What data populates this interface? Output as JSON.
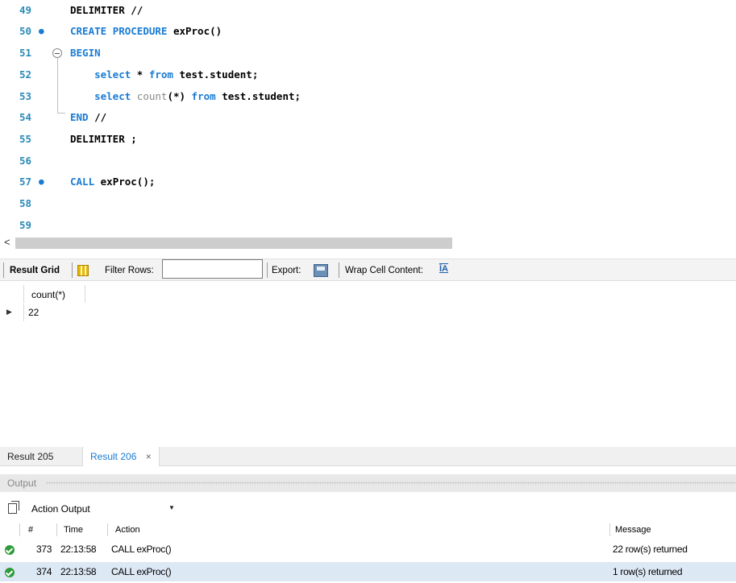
{
  "editor": {
    "lines": [
      {
        "num": "49",
        "code": "DELIMITER //"
      },
      {
        "num": "50",
        "code": "CREATE PROCEDURE exProc()"
      },
      {
        "num": "51",
        "code": "BEGIN"
      },
      {
        "num": "52",
        "code": "    select * from test.student;"
      },
      {
        "num": "53",
        "code": "    select count(*) from test.student;"
      },
      {
        "num": "54",
        "code": "END //"
      },
      {
        "num": "55",
        "code": "DELIMITER ;"
      },
      {
        "num": "56",
        "code": ""
      },
      {
        "num": "57",
        "code": "CALL exProc();"
      },
      {
        "num": "58",
        "code": ""
      },
      {
        "num": "59",
        "code": ""
      }
    ],
    "statement_marker": "●",
    "colors": {
      "keyword": "#1a7bd3",
      "function": "#8a8a8a",
      "line_number": "#2a8ab8"
    }
  },
  "scrollbar": {
    "left_arrow": "<"
  },
  "grid_toolbar": {
    "result_grid_label": "Result Grid",
    "filter_rows_label": "Filter Rows:",
    "filter_value": "",
    "export_label": "Export:",
    "wrap_label": "Wrap Cell Content:",
    "wrap_icon_glyph": "ĪA"
  },
  "result_grid": {
    "columns": [
      "count(*)"
    ],
    "rows": [
      [
        "22"
      ]
    ],
    "current_row_marker": "▶"
  },
  "result_tabs": {
    "tabs": [
      "Result 205",
      "Result 206"
    ],
    "active": "Result 206",
    "close_glyph": "×"
  },
  "output": {
    "title": "Output",
    "selector_value": "Action Output",
    "selector_arrow": "▼",
    "columns": {
      "num": "#",
      "time": "Time",
      "action": "Action",
      "message": "Message"
    },
    "rows": [
      {
        "num": "373",
        "time": "22:13:58",
        "action": "CALL exProc()",
        "message": "22 row(s) returned",
        "status": "ok"
      },
      {
        "num": "374",
        "time": "22:13:58",
        "action": "CALL exProc()",
        "message": "1 row(s) returned",
        "status": "ok"
      }
    ]
  }
}
